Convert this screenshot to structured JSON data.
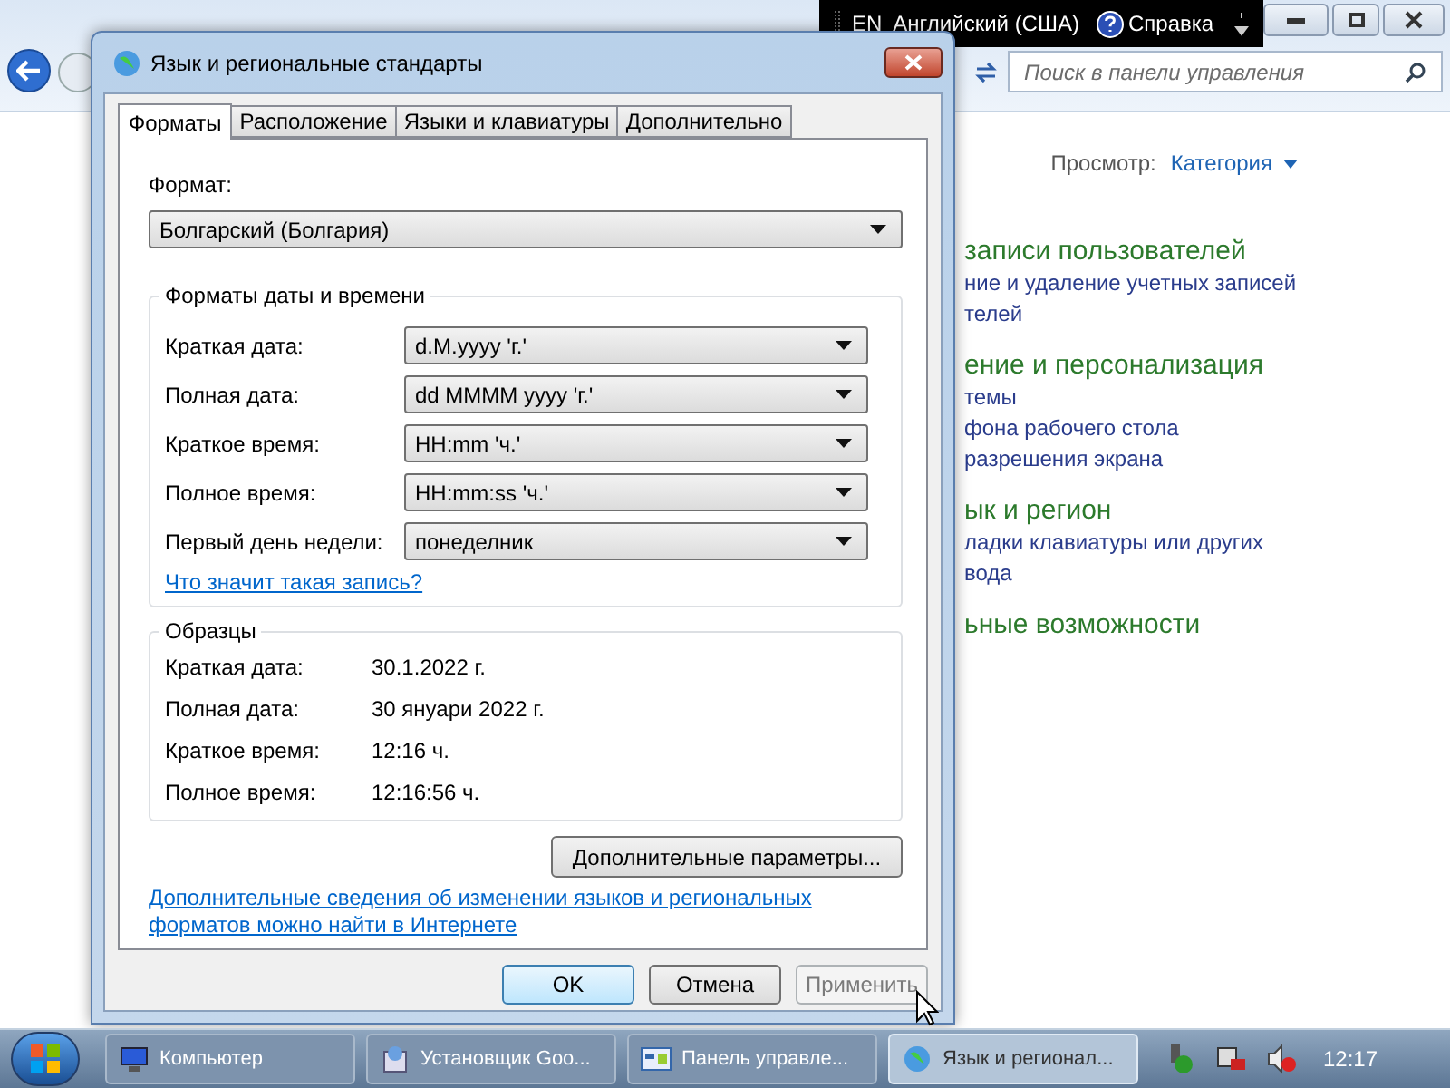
{
  "control_panel": {
    "search_placeholder": "Поиск в панели управления",
    "view_label": "Просмотр:",
    "view_value": "Категория",
    "categories": [
      {
        "title": "записи пользователей",
        "links": [
          "ние и удаление учетных записей",
          "телей"
        ]
      },
      {
        "title": "ение и персонализация",
        "links": [
          "темы",
          "фона рабочего стола",
          "разрешения экрана"
        ]
      },
      {
        "title": "ык и регион",
        "links": [
          "ладки клавиатуры или других",
          "вода"
        ]
      },
      {
        "title": "ьные возможности"
      }
    ]
  },
  "language_bar": {
    "code": "EN",
    "language": "Английский (США)",
    "help": "Справка"
  },
  "dialog": {
    "title": "Язык и региональные стандарты",
    "tabs": [
      {
        "label": "Форматы",
        "selected": true
      },
      {
        "label": "Расположение",
        "selected": false
      },
      {
        "label": "Языки и клавиатуры",
        "selected": false
      },
      {
        "label": "Дополнительно",
        "selected": false
      }
    ],
    "format_label": "Формат:",
    "format_value": "Болгарский (Болгария)",
    "formats_group": {
      "title": "Форматы даты и времени",
      "rows": [
        {
          "label": "Краткая дата:",
          "value": "d.M.yyyy 'г.'"
        },
        {
          "label": "Полная дата:",
          "value": "dd MMMM yyyy 'г.'"
        },
        {
          "label": "Краткое время:",
          "value": "HH:mm 'ч.'"
        },
        {
          "label": "Полное время:",
          "value": "HH:mm:ss 'ч.'"
        },
        {
          "label": "Первый день недели:",
          "value": "понеделник"
        }
      ],
      "link": "Что значит такая запись?"
    },
    "samples_group": {
      "title": "Образцы",
      "rows": [
        {
          "label": "Краткая дата:",
          "value": "30.1.2022 г."
        },
        {
          "label": "Полная дата:",
          "value": "30 януари 2022 г."
        },
        {
          "label": "Краткое время:",
          "value": "12:16 ч."
        },
        {
          "label": "Полное время:",
          "value": "12:16:56 ч."
        }
      ]
    },
    "advanced_button": "Дополнительные параметры...",
    "info_link": "Дополнительные сведения об изменении языков и региональных форматов можно найти в Интернете",
    "buttons": [
      {
        "label": "OK",
        "kind": "default",
        "disabled": false
      },
      {
        "label": "Отмена",
        "kind": "normal",
        "disabled": false
      },
      {
        "label": "Применить",
        "kind": "normal",
        "disabled": true
      }
    ]
  },
  "taskbar": {
    "items": [
      {
        "label": "Компьютер",
        "selected": false
      },
      {
        "label": "Установщик Goo...",
        "selected": false
      },
      {
        "label": "Панель управле...",
        "selected": false
      },
      {
        "label": "Язык и регионал...",
        "selected": true
      }
    ],
    "clock": "12:17"
  }
}
